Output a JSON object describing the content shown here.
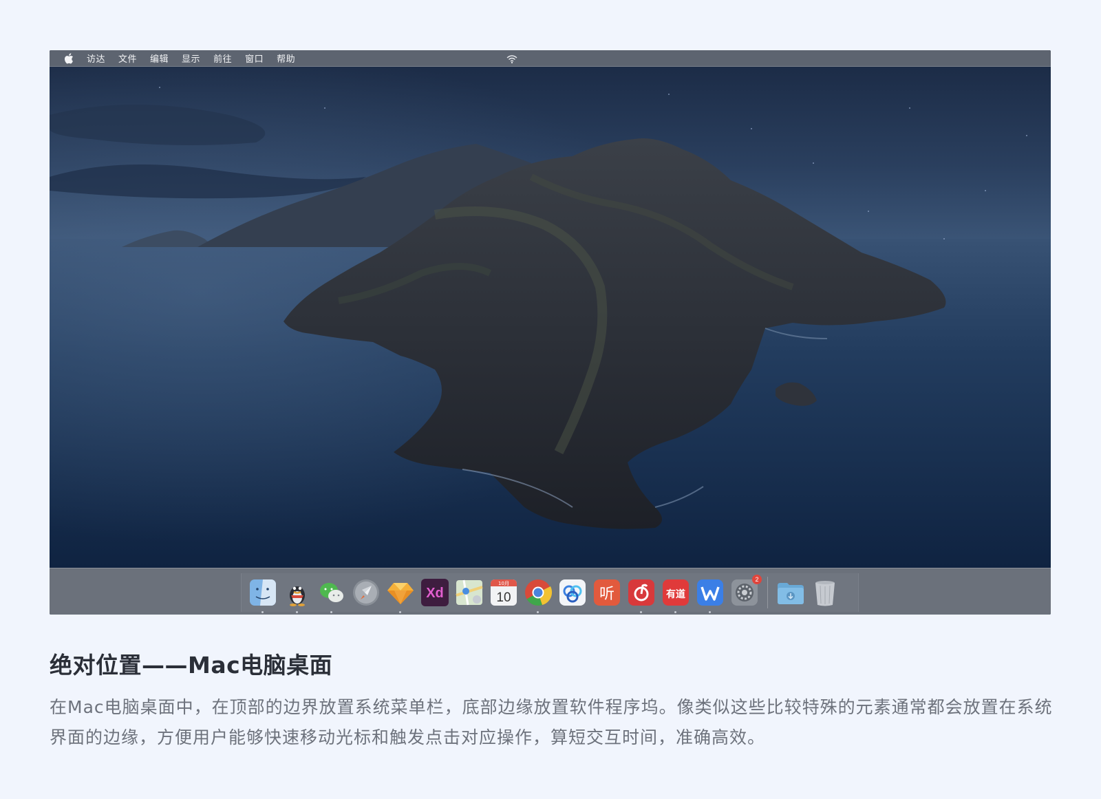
{
  "menubar": {
    "apple_icon": "apple-icon",
    "items": [
      "访达",
      "文件",
      "编辑",
      "显示",
      "前往",
      "窗口",
      "帮助"
    ],
    "status_icon": "wifi-icon"
  },
  "desktop": {
    "wallpaper": "catalina-island-night"
  },
  "dock": {
    "apps": [
      {
        "name": "finder-icon",
        "running": true
      },
      {
        "name": "qq-icon",
        "running": true
      },
      {
        "name": "wechat-icon",
        "running": true
      },
      {
        "name": "launchpad-icon",
        "running": false
      },
      {
        "name": "sketch-icon",
        "running": true
      },
      {
        "name": "xd-icon",
        "label": "Xd",
        "running": false
      },
      {
        "name": "maps-icon",
        "running": false
      },
      {
        "name": "calendar-icon",
        "month": "10月",
        "day": "10",
        "running": false
      },
      {
        "name": "chrome-icon",
        "running": true
      },
      {
        "name": "baidu-netdisk-icon",
        "running": false
      },
      {
        "name": "ting-icon",
        "label": "听",
        "running": false
      },
      {
        "name": "netease-music-icon",
        "running": true
      },
      {
        "name": "youdao-icon",
        "label": "有道",
        "running": true
      },
      {
        "name": "wps-icon",
        "running": true
      },
      {
        "name": "system-preferences-icon",
        "badge": "2",
        "running": false
      }
    ],
    "folders": [
      {
        "name": "downloads-folder-icon"
      },
      {
        "name": "trash-icon"
      }
    ]
  },
  "caption": {
    "title": "绝对位置——Mac电脑桌面",
    "body": "在Mac电脑桌面中，在顶部的边界放置系统菜单栏，底部边缘放置软件程序坞。像类似这些比较特殊的元素通常都会放置在系统界面的边缘，方便用户能够快速移动光标和触发点击对应操作，算短交互时间，准确高效。"
  },
  "colors": {
    "page_bg": "#f1f5fd",
    "menubar_bg": "#5d6470",
    "dock_bg": "#6b717b",
    "title": "#2b2f38",
    "body": "#6d727c"
  }
}
